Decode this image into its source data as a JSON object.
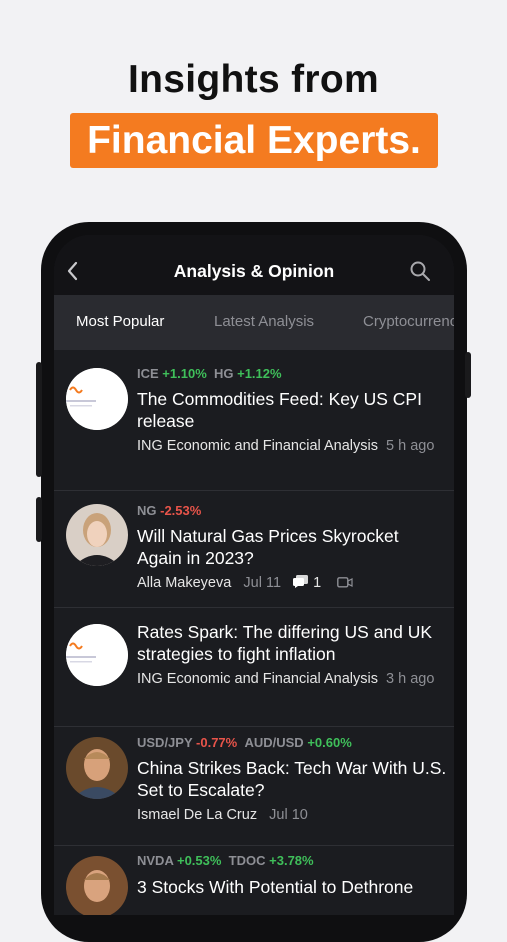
{
  "promo": {
    "headline": "Insights from",
    "highlight": "Financial Experts."
  },
  "header": {
    "title": "Analysis & Opinion"
  },
  "tabs": [
    {
      "label": "Most Popular",
      "active": true
    },
    {
      "label": "Latest Analysis",
      "active": false
    },
    {
      "label": "Cryptocurrency",
      "active": false
    }
  ],
  "articles": [
    {
      "tickers": [
        {
          "symbol": "ICE",
          "change": "+1.10%"
        },
        {
          "symbol": "HG",
          "change": "+1.12%"
        }
      ],
      "title": "The Commodities Feed: Key US CPI release",
      "author": "ING Economic and Financial Analysis",
      "time": "5 h ago"
    },
    {
      "tickers": [
        {
          "symbol": "NG",
          "change": "-2.53%"
        }
      ],
      "title": "Will Natural Gas Prices Skyrocket Again in 2023?",
      "author": "Alla Makeyeva",
      "time": "Jul 11",
      "comments": "1"
    },
    {
      "tickers": [],
      "title": "Rates Spark: The differing US and UK strategies to fight inflation",
      "author": "ING Economic and Financial Analysis",
      "time": "3 h ago"
    },
    {
      "tickers": [
        {
          "symbol": "USD/JPY",
          "change": "-0.77%"
        },
        {
          "symbol": "AUD/USD",
          "change": "+0.60%"
        }
      ],
      "title": "China Strikes Back: Tech War With U.S. Set to Escalate?",
      "author": "Ismael De La Cruz",
      "time": "Jul 10"
    },
    {
      "tickers": [
        {
          "symbol": "NVDA",
          "change": "+0.53%"
        },
        {
          "symbol": "TDOC",
          "change": "+3.78%"
        }
      ],
      "title": "3 Stocks With Potential to Dethrone"
    }
  ],
  "colors": {
    "accent": "#f47b20",
    "positive": "#3fbf5a",
    "negative": "#e8544a"
  }
}
